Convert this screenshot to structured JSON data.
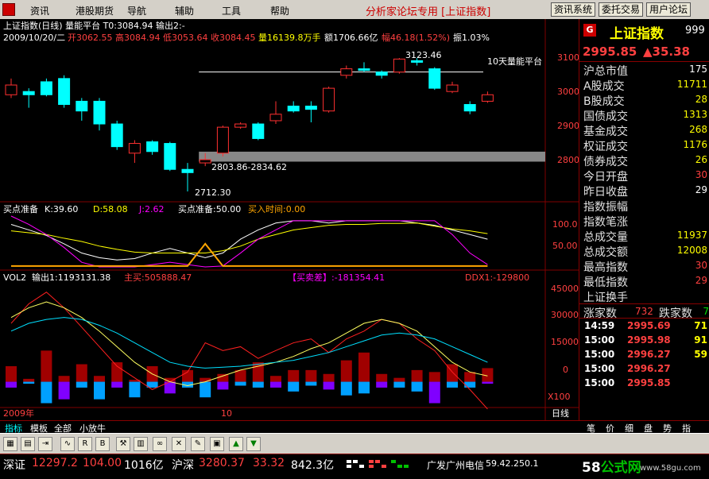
{
  "menubar": {
    "items": [
      "资讯",
      "港股期货",
      "导航",
      "辅助",
      "工具",
      "帮助"
    ],
    "forum_title": "分析家论坛专用 [上证指数]",
    "buttons": [
      "资讯系统",
      "委托交易",
      "用户论坛"
    ]
  },
  "chart_header": {
    "line1": "上证指数(日线) 量能平台  T0:3084.94  输出2:-",
    "line2_date": "2009/10/20/二",
    "open": "开3062.55",
    "high": "高3084.94",
    "low": "低3053.64",
    "close": "收3084.45",
    "volume": "量16139.8万手",
    "amount": "额1706.66亿",
    "change": "幅46.18(1.52%)",
    "swing": "振1.03%"
  },
  "annotations": {
    "high_price": "3123.46",
    "platform_label": "10天量能平台",
    "range_label": "2803.86-2834.62",
    "low_label": "2712.30"
  },
  "kdj_header": {
    "title": "买点准备",
    "k": "K:39.60",
    "d": "D:58.08",
    "j": "J:2.62",
    "prep": "买点准备:50.00",
    "buytime": "买入时间:0.00"
  },
  "vol_header": {
    "title": "VOL2",
    "output": "输出1:1193131.38",
    "buy": "主买:505888.47",
    "net": "【买卖差】:-181354.41",
    "ddx": "DDX1:-129800"
  },
  "axis": {
    "price_ticks": [
      "3100",
      "3000",
      "2900",
      "2800"
    ],
    "kdj_ticks": [
      "100.0",
      "50.00"
    ],
    "vol_ticks": [
      "45000",
      "30000",
      "15000",
      "0"
    ],
    "vol_unit": "X100",
    "x_labels": [
      "2009年",
      "10"
    ],
    "period": "日线"
  },
  "right_panel": {
    "logo": "G",
    "title": "上证指数",
    "code": "999",
    "price": "2995.85",
    "change": "▲35.38",
    "rows": [
      {
        "label": "沪总市值",
        "value": "175",
        "cls": "white"
      },
      {
        "label": "A股成交",
        "value": "11711",
        "cls": ""
      },
      {
        "label": "B股成交",
        "value": "28",
        "cls": ""
      },
      {
        "label": "国债成交",
        "value": "1313",
        "cls": ""
      },
      {
        "label": "基金成交",
        "value": "268",
        "cls": ""
      },
      {
        "label": "权证成交",
        "value": "1176",
        "cls": ""
      },
      {
        "label": "债券成交",
        "value": "26",
        "cls": ""
      },
      {
        "label": "今日开盘",
        "value": "30",
        "cls": "red"
      },
      {
        "label": "昨日收盘",
        "value": "29",
        "cls": "white"
      },
      {
        "label": "指数振幅",
        "value": "",
        "cls": ""
      },
      {
        "label": "指数笔涨",
        "value": "",
        "cls": ""
      },
      {
        "label": "总成交量",
        "value": "11937",
        "cls": ""
      },
      {
        "label": "总成交额",
        "value": "12008",
        "cls": ""
      },
      {
        "label": "最高指数",
        "value": "30",
        "cls": "red"
      },
      {
        "label": "最低指数",
        "value": "29",
        "cls": "red"
      },
      {
        "label": "上证换手",
        "value": "",
        "cls": ""
      }
    ],
    "up_label": "涨家数",
    "up_value": "732",
    "down_label": "跌家数",
    "down_value": "7",
    "ticks": [
      {
        "time": "14:59",
        "price": "2995.69",
        "vol": "71"
      },
      {
        "time": "15:00",
        "price": "2995.98",
        "vol": "91"
      },
      {
        "time": "15:00",
        "price": "2996.27",
        "vol": "59"
      },
      {
        "time": "15:00",
        "price": "2996.27",
        "vol": ""
      },
      {
        "time": "15:00",
        "price": "2995.85",
        "vol": ""
      }
    ]
  },
  "tabs": {
    "left": [
      "指标",
      "模板",
      "全部",
      "小放牛"
    ],
    "right": [
      "笔",
      "价",
      "细",
      "盘",
      "势",
      "指"
    ]
  },
  "toolbar_icons": [
    "grid-icon",
    "book-icon",
    "exit-icon",
    "wave-icon",
    "rsi-icon",
    "bs-icon",
    "tool-icon",
    "chart-icon",
    "pencil-icon",
    "lock-icon",
    "up-arrow-icon",
    "down-arrow-icon"
  ],
  "statusbar": {
    "sz_label": "深证",
    "sz_value": "12297.2",
    "sz_change": "104.00",
    "sz_amount": "1016亿",
    "hs_label": "沪深",
    "hs_value": "3280.37",
    "hs_change": "33.32",
    "hs_amount": "842.3亿",
    "broker": "广发广州电信",
    "ip": "59.42.250.1",
    "logo_a": "58",
    "logo_b": "公式网",
    "url": "www.58gu.com"
  },
  "chart_data": [
    {
      "type": "candlestick",
      "title": "上证指数(日线)",
      "ylim": [
        2690,
        3160
      ],
      "candles": [
        {
          "o": 3010,
          "c": 3040,
          "h": 3060,
          "l": 3000
        },
        {
          "o": 3020,
          "c": 3010,
          "h": 3030,
          "l": 2970
        },
        {
          "o": 3050,
          "c": 3010,
          "h": 3060,
          "l": 3005
        },
        {
          "o": 3060,
          "c": 2980,
          "h": 3070,
          "l": 2970
        },
        {
          "o": 2990,
          "c": 2960,
          "h": 3000,
          "l": 2930
        },
        {
          "o": 2990,
          "c": 2920,
          "h": 3000,
          "l": 2900
        },
        {
          "o": 2920,
          "c": 2850,
          "h": 2930,
          "l": 2840
        },
        {
          "o": 2830,
          "c": 2860,
          "h": 2870,
          "l": 2800
        },
        {
          "o": 2865,
          "c": 2835,
          "h": 2870,
          "l": 2825
        },
        {
          "o": 2860,
          "c": 2780,
          "h": 2865,
          "l": 2775
        },
        {
          "o": 2780,
          "c": 2770,
          "h": 2800,
          "l": 2712
        },
        {
          "o": 2800,
          "c": 2810,
          "h": 2830,
          "l": 2790
        },
        {
          "o": 2830,
          "c": 2910,
          "h": 2915,
          "l": 2820
        },
        {
          "o": 2910,
          "c": 2920,
          "h": 2925,
          "l": 2905
        },
        {
          "o": 2920,
          "c": 2875,
          "h": 2925,
          "l": 2870
        },
        {
          "o": 2930,
          "c": 2950,
          "h": 2990,
          "l": 2920
        },
        {
          "o": 2975,
          "c": 2960,
          "h": 2990,
          "l": 2955
        },
        {
          "o": 2975,
          "c": 2965,
          "h": 2990,
          "l": 2925
        },
        {
          "o": 2960,
          "c": 3030,
          "h": 3035,
          "l": 2955
        },
        {
          "o": 3070,
          "c": 3090,
          "h": 3100,
          "l": 3060
        },
        {
          "o": 3090,
          "c": 3085,
          "h": 3110,
          "l": 3080
        },
        {
          "o": 3080,
          "c": 3070,
          "h": 3085,
          "l": 3060
        },
        {
          "o": 3080,
          "c": 3120,
          "h": 3123,
          "l": 3075
        },
        {
          "o": 3115,
          "c": 3110,
          "h": 3123,
          "l": 3100
        },
        {
          "o": 3090,
          "c": 3030,
          "h": 3095,
          "l": 3025
        },
        {
          "o": 3020,
          "c": 3040,
          "h": 3050,
          "l": 3015
        },
        {
          "o": 2980,
          "c": 2960,
          "h": 2990,
          "l": 2950
        },
        {
          "o": 2990,
          "c": 3010,
          "h": 3020,
          "l": 2985
        }
      ],
      "platform": 3080,
      "band": [
        2803.86,
        2834.62
      ]
    },
    {
      "type": "line",
      "title": "买点准备",
      "ylim": [
        0,
        110
      ],
      "series": [
        {
          "name": "K",
          "color": "#ffffff",
          "values": [
            92,
            80,
            68,
            50,
            30,
            20,
            15,
            18,
            30,
            40,
            30,
            20,
            30,
            60,
            80,
            95,
            100,
            100,
            95,
            100,
            100,
            100,
            100,
            95,
            90,
            80,
            70,
            60
          ]
        },
        {
          "name": "D",
          "color": "#ffff00",
          "values": [
            78,
            74,
            70,
            62,
            55,
            45,
            38,
            32,
            30,
            30,
            30,
            30,
            35,
            45,
            60,
            70,
            80,
            85,
            90,
            92,
            92,
            94,
            94,
            95,
            88,
            82,
            78,
            72
          ]
        },
        {
          "name": "J",
          "color": "#ff00ff",
          "values": [
            110,
            92,
            70,
            42,
            10,
            0,
            0,
            0,
            5,
            10,
            5,
            0,
            2,
            30,
            60,
            80,
            100,
            100,
            100,
            100,
            100,
            100,
            100,
            100,
            100,
            70,
            30,
            5
          ]
        },
        {
          "name": "买点准备",
          "color": "#ffa500",
          "values": [
            2,
            2,
            2,
            2,
            2,
            2,
            2,
            2,
            2,
            2,
            2,
            50,
            2,
            2,
            2,
            2,
            2,
            2,
            2,
            2,
            2,
            2,
            2,
            2,
            2,
            2,
            2,
            2
          ]
        }
      ]
    },
    {
      "type": "bar",
      "title": "VOL2",
      "ylim": [
        -12000,
        50000
      ],
      "up_bars": [
        8000,
        1500,
        16000,
        3000,
        9000,
        3000,
        10000,
        1000,
        8000,
        2000,
        6000,
        2000,
        4000,
        6000,
        10000,
        3000,
        6000,
        6000,
        4000,
        11000,
        15000,
        4000,
        2000,
        6000,
        5000,
        9000,
        5000,
        7000
      ],
      "down_bars": [
        -3000,
        -1000,
        -11000,
        -9000,
        -3000,
        -9000,
        -3000,
        -8000,
        -3000,
        -6000,
        -3000,
        -8000,
        -4000,
        -2000,
        -3000,
        -3000,
        -5000,
        -2000,
        -4000,
        -7000,
        -6000,
        -3000,
        -3000,
        -5000,
        -11000,
        -3000,
        -3000,
        -1000
      ],
      "series": [
        {
          "name": "line-red",
          "color": "#ff2020",
          "values": [
            30000,
            40000,
            46000,
            38000,
            28000,
            18000,
            8000,
            2000,
            -4000,
            0,
            5000,
            20000,
            16000,
            18000,
            12000,
            16000,
            20000,
            22000,
            15000,
            22000,
            26000,
            32000,
            30000,
            22000,
            16000,
            5000,
            -4000,
            -14000
          ]
        },
        {
          "name": "line-yellow",
          "color": "#ffff60",
          "values": [
            33000,
            38000,
            41000,
            38000,
            33000,
            26000,
            18000,
            10000,
            4000,
            0,
            -2000,
            0,
            3000,
            6000,
            8000,
            10000,
            13000,
            17000,
            20000,
            25000,
            30000,
            32000,
            30000,
            26000,
            18000,
            10000,
            5000,
            3000
          ]
        },
        {
          "name": "line-cyan",
          "color": "#00e0ff",
          "values": [
            26000,
            30000,
            32000,
            33000,
            32000,
            29000,
            25000,
            20000,
            15000,
            10000,
            8000,
            7000,
            7500,
            8000,
            9000,
            10000,
            11000,
            13000,
            15000,
            18000,
            21000,
            24000,
            25000,
            24000,
            22000,
            18000,
            14000,
            10000
          ]
        }
      ]
    }
  ]
}
